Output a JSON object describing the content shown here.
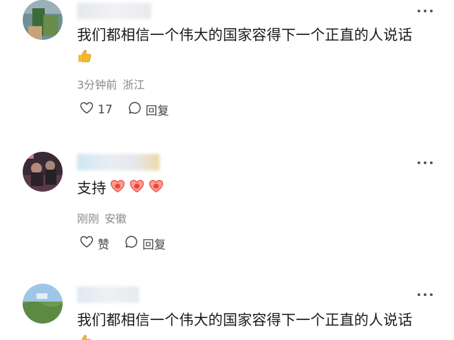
{
  "comments": [
    {
      "text": "我们都相信一个伟大的国家容得下一个正直的人说话",
      "emoji": "thumbs-up-icon",
      "time": "3分钟前",
      "location": "浙江",
      "like_count": "17",
      "reply_label": "回复"
    },
    {
      "text": "支持",
      "emoji": "heart-icon",
      "time": "刚刚",
      "location": "安徽",
      "like_label": "赞",
      "reply_label": "回复"
    },
    {
      "text": "我们都相信一个伟大的国家容得下一个正直的人说话",
      "emoji": "thumbs-up-icon"
    }
  ],
  "colors": {
    "thumbs_up": "#f5b928",
    "heart_outer": "#ff9b8f",
    "heart_inner": "#e8453c",
    "meta_text": "#8a8a8a",
    "icon_stroke": "#444444"
  }
}
